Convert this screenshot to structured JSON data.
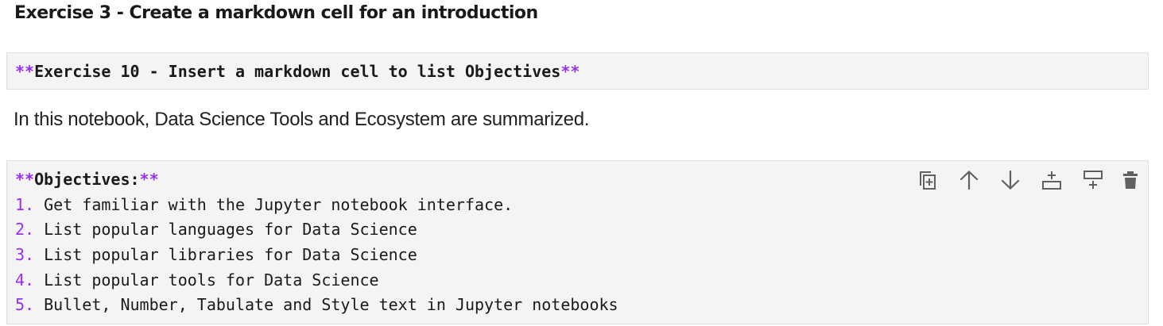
{
  "heading": "Exercise 3 - Create a markdown cell for an introduction",
  "cell_exercise10": {
    "md_open": "**",
    "text": "Exercise 10 - Insert a markdown cell to list Objectives",
    "md_close": "**"
  },
  "intro_paragraph": "In this notebook, Data Science Tools and Ecosystem are summarized.",
  "cell_objectives": {
    "title_md_open": "**",
    "title": "Objectives:",
    "title_md_close": "**",
    "items": [
      {
        "num": "1.",
        "text": " Get familiar with the Jupyter notebook interface."
      },
      {
        "num": "2.",
        "text": " List popular languages for Data Science"
      },
      {
        "num": "3.",
        "text": " List popular libraries for Data Science"
      },
      {
        "num": "4.",
        "text": " List popular tools for Data Science"
      },
      {
        "num": "5.",
        "text": " Bullet, Number, Tabulate and Style text in Jupyter notebooks"
      }
    ]
  },
  "toolbar": {
    "icons": [
      "duplicate-cell-icon",
      "move-up-icon",
      "move-down-icon",
      "insert-cell-above-icon",
      "insert-cell-below-icon",
      "delete-cell-icon"
    ],
    "icon_color": "#616161"
  },
  "colors": {
    "markdown_syntax": "#9b2cf5",
    "cell_background": "#f4f4f4"
  }
}
